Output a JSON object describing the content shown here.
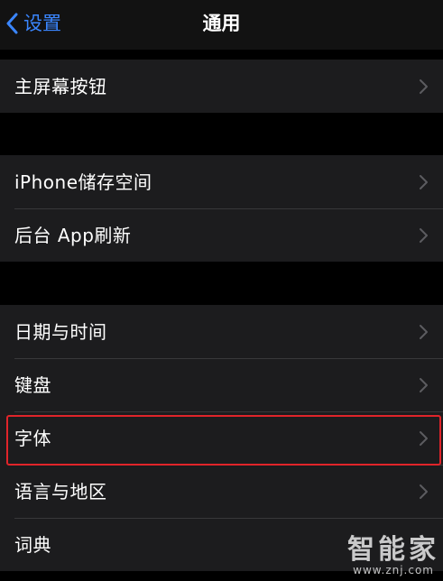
{
  "navbar": {
    "back_label": "设置",
    "title": "通用"
  },
  "groups": [
    {
      "items": [
        {
          "label": "主屏幕按钮"
        }
      ]
    },
    {
      "items": [
        {
          "label": "iPhone储存空间"
        },
        {
          "label": "后台 App刷新"
        }
      ]
    },
    {
      "items": [
        {
          "label": "日期与时间"
        },
        {
          "label": "键盘"
        },
        {
          "label": "字体"
        },
        {
          "label": "语言与地区"
        },
        {
          "label": "词典"
        }
      ]
    }
  ],
  "highlighted_item": "字体",
  "watermark": {
    "main": "智能家",
    "sub": "www.znj.com"
  },
  "colors": {
    "background": "#000000",
    "cell_background": "#1c1c1e",
    "accent": "#3a86ff",
    "chevron": "#5c5c60",
    "highlight_border": "#e0242a"
  },
  "icons": {
    "back": "chevron-left-icon",
    "disclosure": "chevron-right-icon"
  }
}
